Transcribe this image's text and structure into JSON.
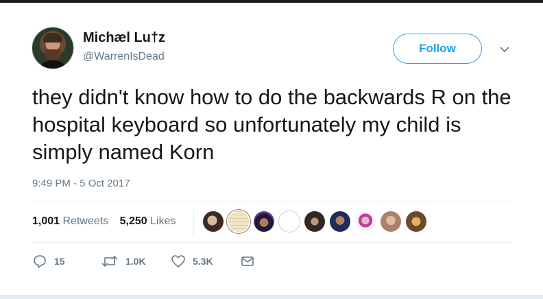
{
  "user": {
    "display_name": "Michæl Lu†z",
    "handle": "@WarrenIsDead"
  },
  "follow_button": {
    "label": "Follow"
  },
  "tweet": {
    "text": "they didn't know how to do the backwards R on the hospital keyboard so unfortunately my child is simply named Korn",
    "timestamp": "9:49 PM - 5 Oct 2017"
  },
  "stats": {
    "retweets_count": "1,001",
    "retweets_label": "Retweets",
    "likes_count": "5,250",
    "likes_label": "Likes"
  },
  "actions": {
    "reply_count": "15",
    "retweet_count": "1.0K",
    "like_count": "5.3K"
  },
  "icons": {
    "menu": "chevron-down-icon",
    "reply": "reply-icon",
    "retweet": "retweet-icon",
    "like": "heart-icon",
    "dm": "envelope-icon"
  },
  "colors": {
    "accent": "#1da1f2",
    "text": "#14171a",
    "muted": "#657786",
    "divider": "#e6ecf0"
  }
}
